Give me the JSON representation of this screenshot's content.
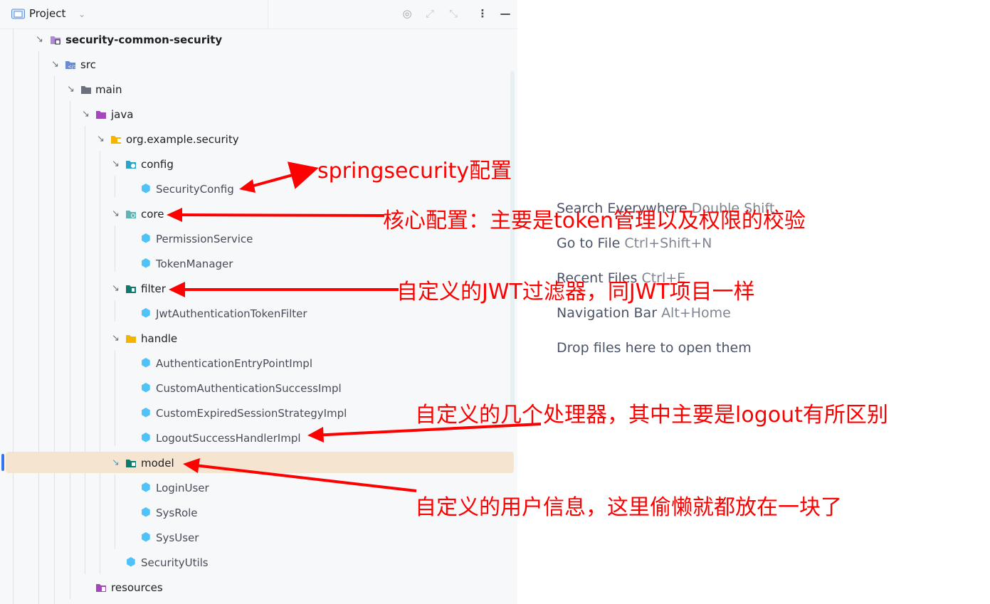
{
  "header": {
    "title": "Project",
    "icons": [
      "locate-icon",
      "expand-all-icon",
      "collapse-all-icon",
      "more-options-icon",
      "minimize-icon"
    ]
  },
  "tree": {
    "module": "security-common-security",
    "src": "src",
    "main": "main",
    "java": "java",
    "package": "org.example.security",
    "config": "config",
    "config_files": [
      "SecurityConfig"
    ],
    "core": "core",
    "core_files": [
      "PermissionService",
      "TokenManager"
    ],
    "filter": "filter",
    "filter_files": [
      "JwtAuthenticationTokenFilter"
    ],
    "handle": "handle",
    "handle_files": [
      "AuthenticationEntryPointImpl",
      "CustomAuthenticationSuccessImpl",
      "CustomExpiredSessionStrategyImpl",
      "LogoutSuccessHandlerImpl"
    ],
    "model": "model",
    "model_files": [
      "LoginUser",
      "SysRole",
      "SysUser"
    ],
    "utils": "SecurityUtils",
    "resources": "resources"
  },
  "editor_hints": [
    {
      "label": "Search Everywhere",
      "shortcut": "Double Shift"
    },
    {
      "label": "Go to File",
      "shortcut": "Ctrl+Shift+N"
    },
    {
      "label": "Recent Files",
      "shortcut": "Ctrl+E"
    },
    {
      "label": "Navigation Bar",
      "shortcut": "Alt+Home"
    },
    {
      "label": "Drop files here to open them",
      "shortcut": ""
    }
  ],
  "annotations": [
    "springsecurity配置",
    "核心配置：主要是token管理以及权限的校验",
    "自定义的JWT过滤器，同JWT项目一样",
    "自定义的几个处理器，其中主要是logout有所区别",
    "自定义的用户信息，这里偷懒就都放在一块了"
  ],
  "colors": {
    "annotation": "#ff0000",
    "selection": "#f5e5d0",
    "class_icon": "#4fc3f7",
    "folder": "#f4b400"
  }
}
